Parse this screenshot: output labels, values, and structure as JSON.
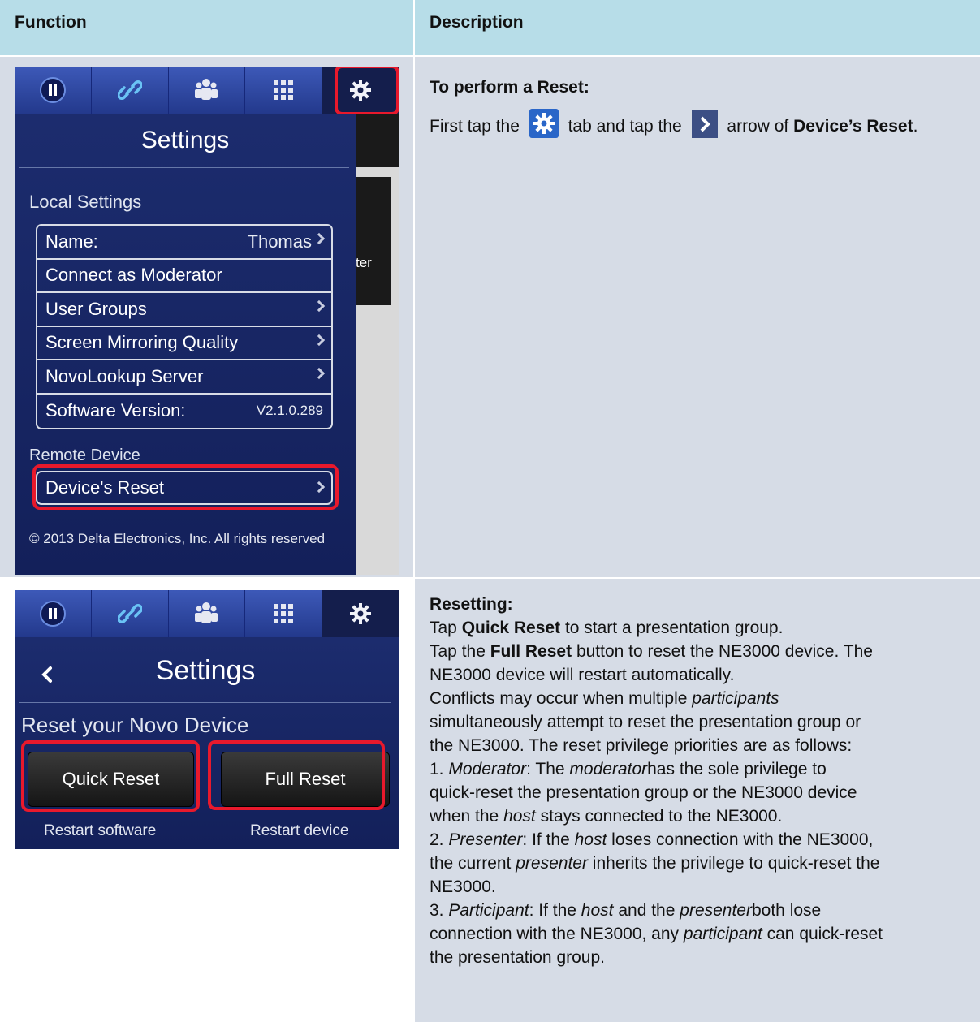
{
  "header": {
    "function": "Function",
    "description": "Description"
  },
  "row1": {
    "heading": "To perform a Reset:",
    "text_1": "First tap the",
    "text_2": "tab and tap the",
    "text_3": "arrow of",
    "text_bold": "Device’s Reset",
    "text_end": "."
  },
  "screen1": {
    "title": "Settings",
    "local_settings": "Local Settings",
    "items": [
      {
        "label": "Name:",
        "value": "Thomas"
      },
      {
        "label": "Connect as Moderator"
      },
      {
        "label": "User Groups"
      },
      {
        "label": "Screen Mirroring Quality"
      },
      {
        "label": "NovoLookup Server"
      },
      {
        "label": "Software Version:",
        "value": "V2.1.0.289"
      }
    ],
    "remote_device": "Remote Device",
    "reset_item": "Device's Reset",
    "side_fragment": "ter",
    "copyright": "© 2013 Delta Electronics, Inc. All rights reserved"
  },
  "screen2": {
    "title": "Settings",
    "subtitle": "Reset your Novo Device",
    "quick_reset": "Quick Reset",
    "full_reset": "Full Reset",
    "restart_software": "Restart software",
    "restart_device": "Restart device"
  },
  "row2": {
    "heading": "Resetting:",
    "l1a": "Tap",
    "l1b": "Quick Reset",
    "l1c": "to start a presentation group.",
    "l2a": "Tap the",
    "l2b": "Full Reset",
    "l2c": "button to reset the NE3000 device. The",
    "l3": "NE3000 device will restart automatically.",
    "l4a": "Conflicts may occur when multiple",
    "l4b": "participants",
    "l5": "simultaneously attempt to reset the presentation group or",
    "l6": "the NE3000. The reset privilege priorities are as follows:",
    "l7a": "1.",
    "l7b": "Moderator",
    "l7c": ": The",
    "l7d": "moderator",
    "l7e": "has the sole privilege to",
    "l8": "quick-reset the presentation group or the NE3000 device",
    "l9a": "when the",
    "l9b": "host",
    "l9c": "stays connected to the NE3000.",
    "l10a": "2.",
    "l10b": "Presenter",
    "l10c": ": If the",
    "l10d": "host",
    "l10e": "loses connection with the NE3000,",
    "l11a": "the current",
    "l11b": "presenter",
    "l11c": "inherits the privilege to quick-reset the",
    "l12": "NE3000.",
    "l13a": "3.",
    "l13b": "Participant",
    "l13c": ": If the",
    "l13d": "host",
    "l13e": "and the",
    "l13f": "presenter",
    "l13g": "both lose",
    "l14a": "connection with the NE3000, any",
    "l14b": "participant",
    "l14c": "can quick-reset",
    "l15": "the presentation group."
  }
}
